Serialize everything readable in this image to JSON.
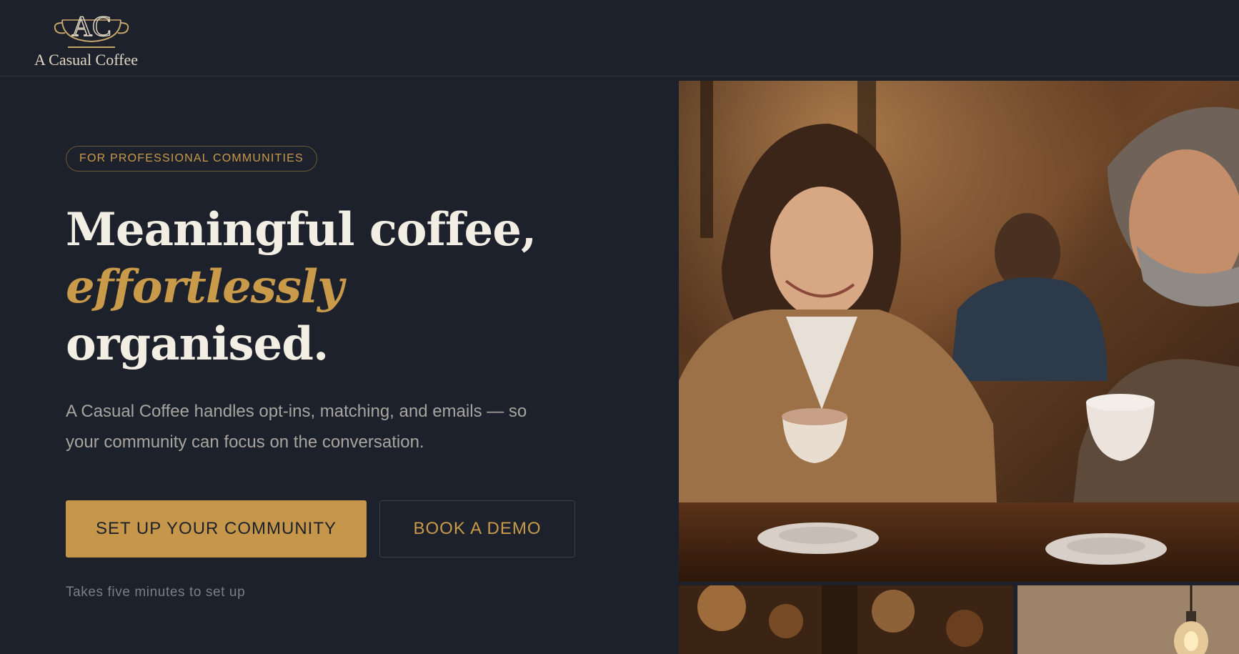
{
  "header": {
    "logo_monogram": "AC",
    "logo_text": "A Casual Coffee"
  },
  "hero": {
    "eyebrow": "FOR PROFESSIONAL COMMUNITIES",
    "headline_line1": "Meaningful coffee,",
    "headline_accent": "effortlessly",
    "headline_line3": "organised.",
    "subtext": "A Casual Coffee handles opt-ins, matching, and emails — so your community can focus on the conversation.",
    "primary_cta": "SET UP YOUR COMMUNITY",
    "secondary_cta": "BOOK A DEMO",
    "hint": "Takes five minutes to set up"
  },
  "colors": {
    "background": "#1c212b",
    "accent": "#c6974a",
    "text_primary": "#f3eee4",
    "text_muted": "#a8a59e"
  }
}
